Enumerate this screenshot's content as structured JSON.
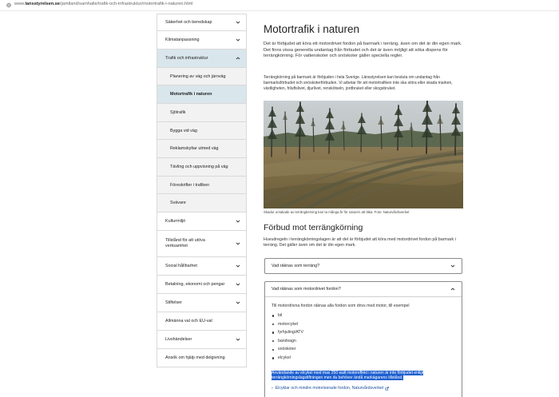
{
  "browser": {
    "url_prefix": "www.",
    "url_domain": "lansstyrelsen.se",
    "url_path": "/jamtland/samhalle/trafik-och-infrastruktur/motortrafik-i-naturen.html"
  },
  "sidebar": {
    "items": [
      {
        "label": "Säkerhet och beredskap"
      },
      {
        "label": "Klimatanpassning"
      },
      {
        "label": "Trafik och infrastruktur"
      }
    ],
    "subitems": [
      {
        "label": "Planering av väg och järnväg"
      },
      {
        "label": "Motortrafik i naturen"
      },
      {
        "label": "Sjötrafik"
      },
      {
        "label": "Bygga vid väg"
      },
      {
        "label": "Reklamskyltar utmed väg"
      },
      {
        "label": "Tävling och uppvisning på väg"
      },
      {
        "label": "Föreskrifter i trafiken"
      },
      {
        "label": "Svävare"
      }
    ],
    "more": [
      {
        "label": "Kulturmiljö"
      },
      {
        "label": "Tillstånd för att utöva verksamhet"
      },
      {
        "label": "Social hållbarhet"
      },
      {
        "label": "Betalning, ekonomi och pengar"
      },
      {
        "label": "Stiftelser"
      },
      {
        "label": "Allmänna val och EU-val"
      },
      {
        "label": "Livshändelser"
      },
      {
        "label": "Ansök om hjälp med delgivning"
      }
    ]
  },
  "main": {
    "title": "Motortrafik i naturen",
    "lead": "Det är förbjudet att köra ett motordrivet fordon på barmark i terräng, även om det är din egen mark. Det finns vissa generella undantag från förbudet och det är även möjligt att söka dispens för terrängkörning. För vattenskoter och snöskoter gäller speciella regler.",
    "paragraph": "Terrängkörning på barmark är förbjuden i hela Sverige. Länsstyrelsen kan besluta om undantag från barmarksförbudet och snöskoterförbuden. Vi arbetar för att motortrafiken inte ska störa eller skada marken, växtligheten, friluftslivet, djurlivet, renskötseln, jordbruket eller skogsbruket.",
    "caption": "Skador orsakade av terrängkörning kan ta många år för naturen att läka. Foto: Naturvårdsverket",
    "section_title": "Förbud mot terrängkörning",
    "section_text": "Huvudregeln i terrängkörningslagen är att det är förbjudet att köra med motordrivet fordon på barmark i terräng. Det gäller även om det är din egen mark.",
    "accordion1": {
      "label": "Vad räknas som terräng?"
    },
    "accordion2": {
      "label": "Vad räknas som motordrivet fordon?",
      "intro": "Till motordrivna fordon räknas alla fordon som drivs med motor, till exempel",
      "list": [
        "bil",
        "motorcykel",
        "fyrhjuling/ATV",
        "bandvagn",
        "snöskoter",
        "elcykel"
      ],
      "highlight": "Användande av elcykel med max 250 watt motoreffekt i naturen är inte förbjudet enligt terrängkörningslagstiftningen men du behöver ändå markägarens tillstånd.",
      "link": "Elcyklar och mindre motoriserade fordon, Naturvårdsverket"
    }
  }
}
